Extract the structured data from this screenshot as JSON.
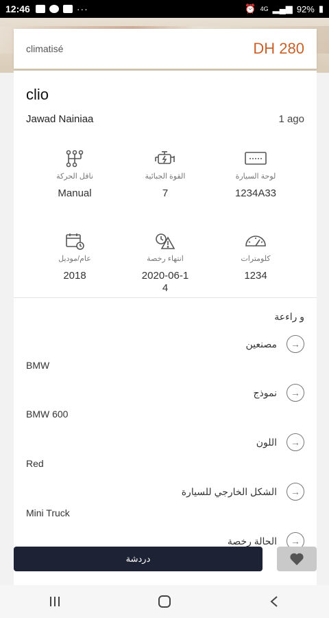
{
  "status_bar": {
    "time": "12:46",
    "battery": "92%",
    "signal_label": "4G",
    "more": "···"
  },
  "listing": {
    "tag": "climatisé",
    "price": "DH 280",
    "title": "clio",
    "owner": "Jawad Nainiaa",
    "posted": "1 ago"
  },
  "specs": [
    {
      "label": "ناقل الحركة",
      "value": "Manual",
      "icon": "gearbox-icon"
    },
    {
      "label": "القوة الجبائية",
      "value": "7",
      "icon": "engine-icon"
    },
    {
      "label": "لوحة السيارة",
      "value": "1234A33",
      "icon": "plate-icon"
    },
    {
      "label": "عام/موديل",
      "value": "2018",
      "icon": "calendar-icon"
    },
    {
      "label": "انتهاء رخصة",
      "value": "2020-06-1\n4",
      "icon": "license-alert-icon"
    },
    {
      "label": "كلومترات",
      "value": "1234",
      "icon": "speedometer-icon"
    }
  ],
  "details": {
    "section_title": "و راءعة",
    "items": [
      {
        "label": "مصنعين",
        "value": "BMW"
      },
      {
        "label": "نموذج",
        "value": "BMW 600"
      },
      {
        "label": "اللون",
        "value": "Red"
      },
      {
        "label": "الشكل الخارجي للسيارة",
        "value": "Mini Truck"
      },
      {
        "label": "الحالة رخصة",
        "value": ""
      }
    ]
  },
  "actions": {
    "chat": "دردشة"
  },
  "colors": {
    "accent": "#c8602a",
    "button": "#1e2235"
  }
}
